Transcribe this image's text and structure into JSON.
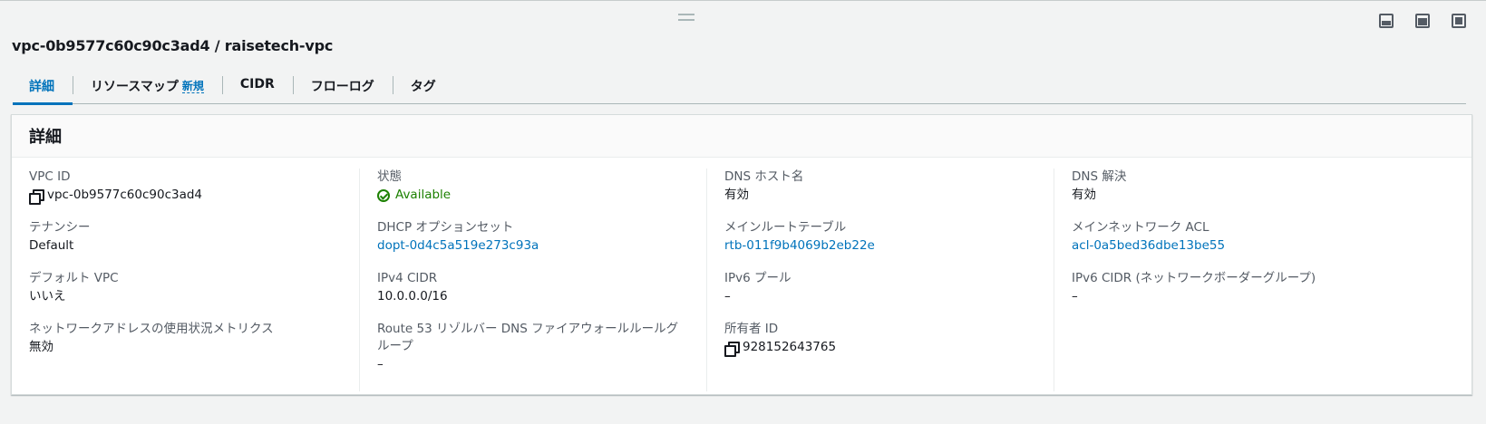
{
  "panel": {
    "title": "vpc-0b9577c60c90c3ad4 / raisetech-vpc"
  },
  "tabs": [
    {
      "label": "詳細",
      "badge": ""
    },
    {
      "label": "リソースマップ",
      "badge": "新規"
    },
    {
      "label": "CIDR",
      "badge": ""
    },
    {
      "label": "フローログ",
      "badge": ""
    },
    {
      "label": "タグ",
      "badge": ""
    }
  ],
  "details": {
    "header": "詳細",
    "col1": [
      {
        "label": "VPC ID",
        "value": "vpc-0b9577c60c90c3ad4"
      },
      {
        "label": "テナンシー",
        "value": "Default"
      },
      {
        "label": "デフォルト VPC",
        "value": "いいえ"
      },
      {
        "label": "ネットワークアドレスの使用状況メトリクス",
        "value": "無効"
      }
    ],
    "col2": [
      {
        "label": "状態",
        "value": "Available"
      },
      {
        "label": "DHCP オプションセット",
        "value": "dopt-0d4c5a519e273c93a"
      },
      {
        "label": "IPv4 CIDR",
        "value": "10.0.0.0/16"
      },
      {
        "label": "Route 53 リゾルバー DNS ファイアウォールルールグループ",
        "value": "–"
      }
    ],
    "col3": [
      {
        "label": "DNS ホスト名",
        "value": "有効"
      },
      {
        "label": "メインルートテーブル",
        "value": "rtb-011f9b4069b2eb22e"
      },
      {
        "label": "IPv6 プール",
        "value": "–"
      },
      {
        "label": "所有者 ID",
        "value": "928152643765"
      }
    ],
    "col4": [
      {
        "label": "DNS 解決",
        "value": "有効"
      },
      {
        "label": "メインネットワーク ACL",
        "value": "acl-0a5bed36dbe13be55"
      },
      {
        "label": "IPv6 CIDR (ネットワークボーダーグループ)",
        "value": "–"
      }
    ]
  },
  "icons": {
    "copy": "copy-icon",
    "status": "check-circle-icon",
    "pref_bottom": "split-panel-bottom-icon",
    "pref_side": "split-panel-side-icon",
    "pref_full": "maximize-icon"
  },
  "colors": {
    "link": "#0073bb",
    "success": "#1d8102",
    "label": "#545b64"
  }
}
